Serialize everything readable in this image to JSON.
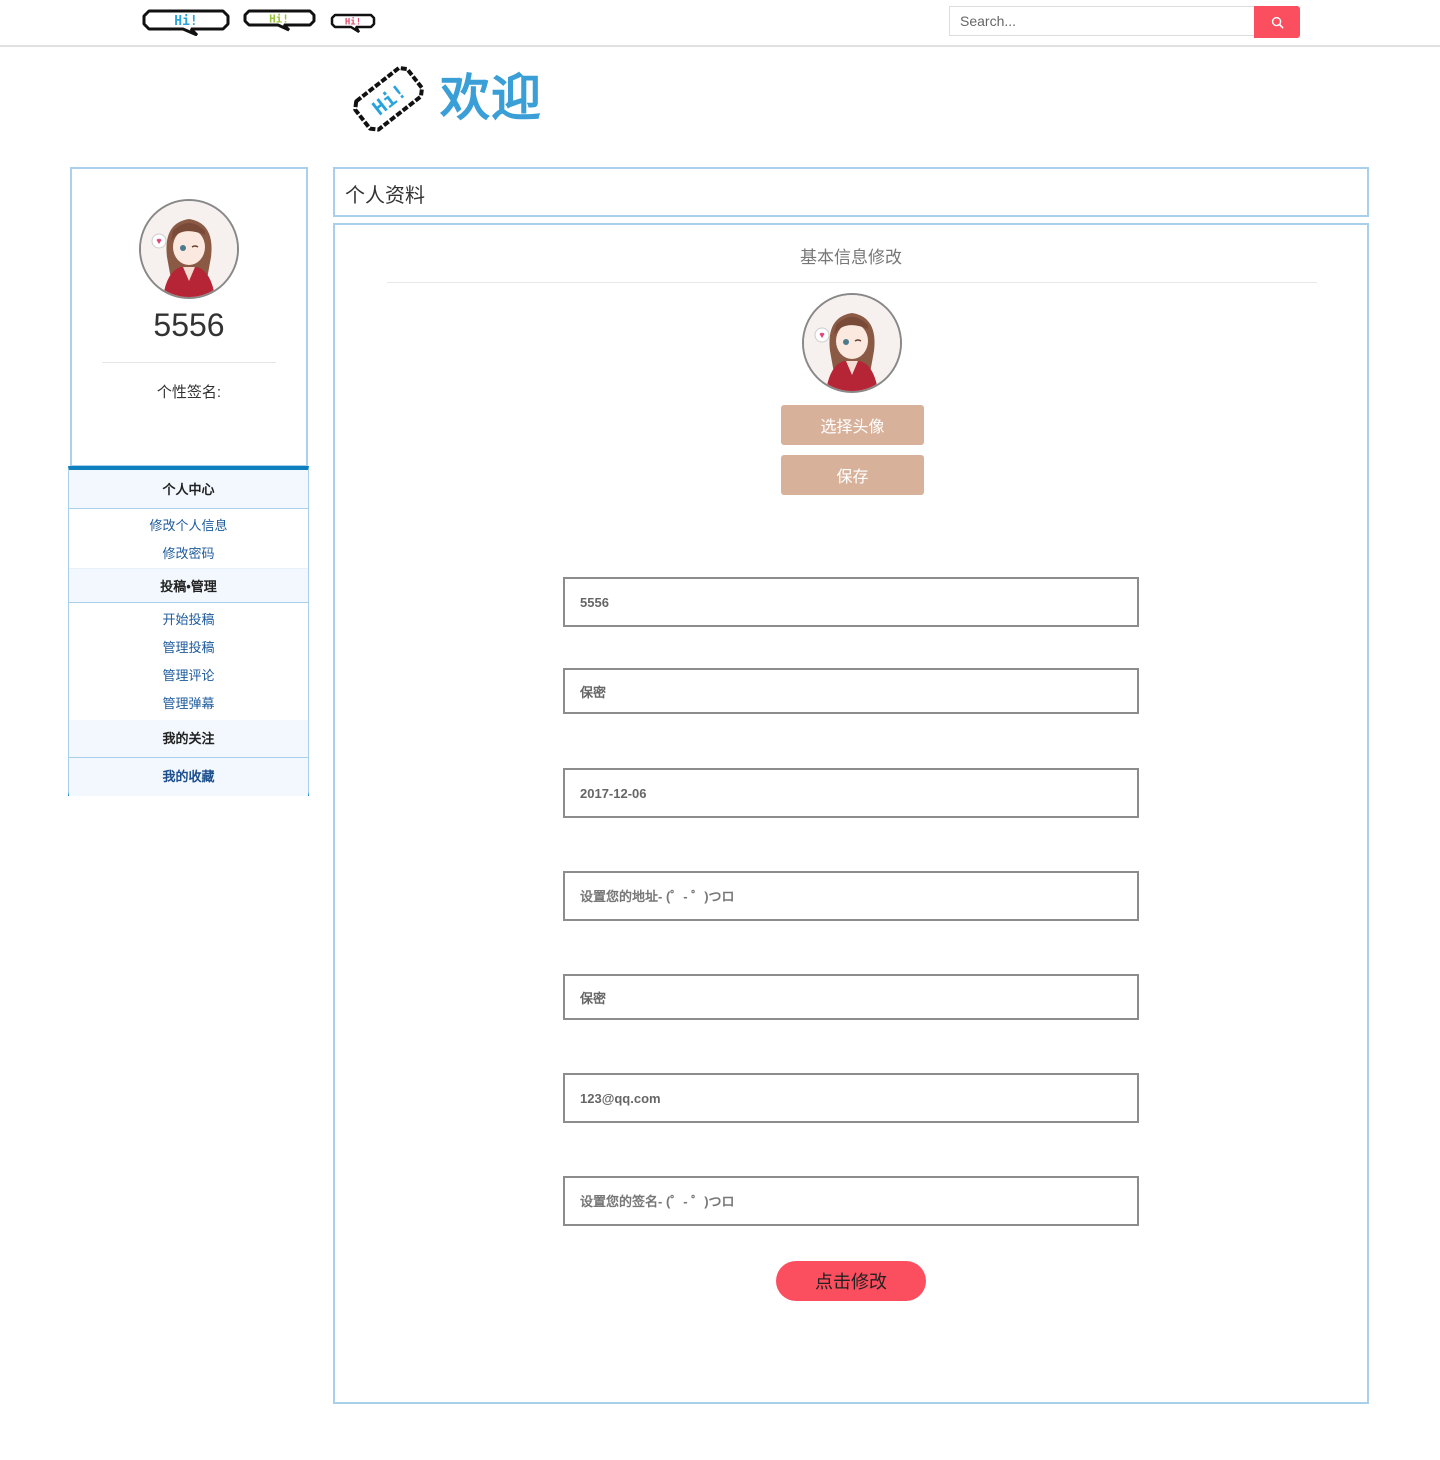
{
  "header": {
    "logo_badges": [
      "Hi!",
      "Hi!",
      "Hi!"
    ],
    "search": {
      "placeholder": "Search..."
    }
  },
  "welcome": {
    "logo_text": "Hi!",
    "title": "欢迎"
  },
  "profile": {
    "username": "5556",
    "signature_label": "个性签名:"
  },
  "sidebar": {
    "groups": [
      {
        "label": "个人中心",
        "items": [
          "修改个人信息",
          "修改密码"
        ]
      },
      {
        "label": "投稿•管理",
        "items": [
          "开始投稿",
          "管理投稿",
          "管理评论",
          "管理弹幕"
        ]
      },
      {
        "label": "我的关注",
        "items": []
      },
      {
        "label": "我的收藏",
        "items": []
      }
    ]
  },
  "main": {
    "panel_title": "个人资料",
    "section_title": "基本信息修改",
    "choose_avatar_label": "选择头像",
    "save_label": "保存",
    "fields": [
      {
        "value": "5556",
        "placeholder": ""
      },
      {
        "value": "保密",
        "placeholder": ""
      },
      {
        "value": "2017-12-06",
        "placeholder": ""
      },
      {
        "value": "",
        "placeholder": "设置您的地址- (゜- ゜)つロ"
      },
      {
        "value": "保密",
        "placeholder": ""
      },
      {
        "value": "123@qq.com",
        "placeholder": ""
      },
      {
        "value": "",
        "placeholder": "设置您的签名- (゜- ゜)つロ"
      }
    ],
    "submit_label": "点击修改"
  },
  "colors": {
    "accent_red": "#fb4e5e",
    "accent_blue": "#3a9fd6",
    "panel_border": "#a9d0ea",
    "menu_border": "#0e80c0",
    "tan_button": "#d8b19a",
    "badge_blue": "#29a3dd",
    "badge_green": "#9ac53a",
    "badge_pink": "#e24d6f"
  },
  "icons": {
    "search": "search-icon",
    "avatar": "anime-girl-avatar"
  }
}
